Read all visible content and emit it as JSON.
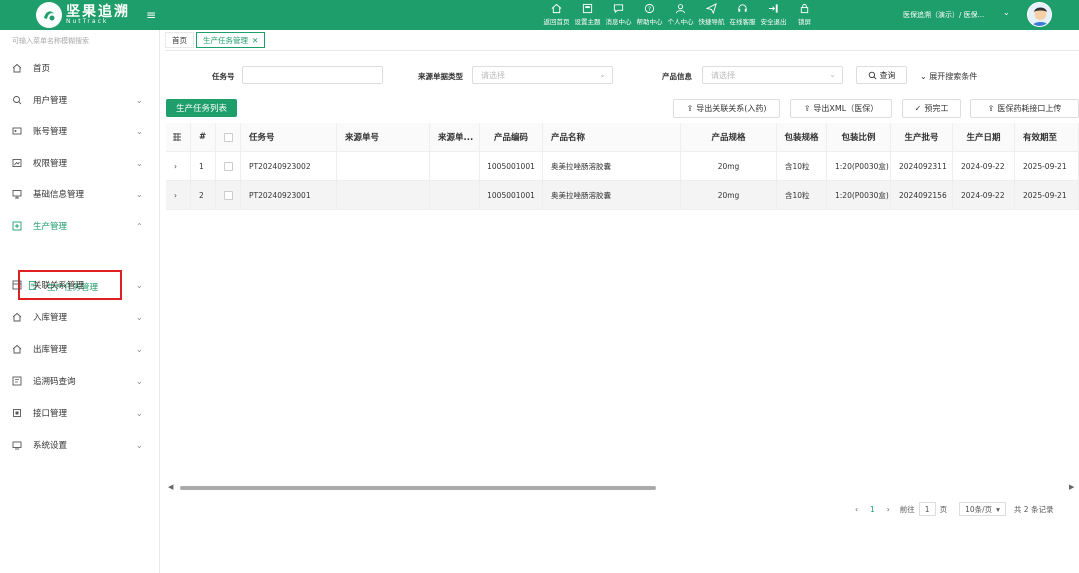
{
  "header": {
    "brand_name": "坚果追溯",
    "brand_sub": "NutTrack",
    "nav": [
      {
        "label": "返回首页",
        "icon": "home-icon"
      },
      {
        "label": "设置主题",
        "icon": "theme-icon"
      },
      {
        "label": "消息中心",
        "icon": "message-icon"
      },
      {
        "label": "帮助中心",
        "icon": "help-icon"
      },
      {
        "label": "个人中心",
        "icon": "user-icon"
      },
      {
        "label": "快捷导航",
        "icon": "send-icon"
      },
      {
        "label": "在线客服",
        "icon": "headset-icon"
      },
      {
        "label": "安全退出",
        "icon": "logout-icon"
      },
      {
        "label": "锁屏",
        "icon": "lock-icon"
      }
    ],
    "user": "医保追溯（演示）/ 医保...",
    "accent": "#1e9e6a"
  },
  "sidebar": {
    "search_placeholder": "可输入菜单名称模糊搜索",
    "items": [
      {
        "label": "首页",
        "icon": "home-icon"
      },
      {
        "label": "用户管理",
        "icon": "user-search-icon"
      },
      {
        "label": "账号管理",
        "icon": "account-icon"
      },
      {
        "label": "权限管理",
        "icon": "permission-icon"
      },
      {
        "label": "基础信息管理",
        "icon": "monitor-icon"
      },
      {
        "label": "生产管理",
        "icon": "production-icon"
      },
      {
        "label": "关联关系管理",
        "icon": "relation-icon"
      },
      {
        "label": "入库管理",
        "icon": "warehouse-in-icon"
      },
      {
        "label": "出库管理",
        "icon": "warehouse-out-icon"
      },
      {
        "label": "追溯码查询",
        "icon": "trace-icon"
      },
      {
        "label": "接口管理",
        "icon": "api-icon"
      },
      {
        "label": "系统设置",
        "icon": "settings-icon"
      }
    ],
    "sub_item": "生产任务管理"
  },
  "tabs": [
    {
      "label": "首页"
    },
    {
      "label": "生产任务管理"
    }
  ],
  "filters": {
    "task_no_label": "任务号",
    "source_type_label": "来源单据类型",
    "source_type_placeholder": "请选择",
    "product_label": "产品信息",
    "product_placeholder": "请选择",
    "query_btn": "查询",
    "expand": "展开搜索条件"
  },
  "toolbar": {
    "list_btn": "生产任务列表",
    "export_rel": "导出关联关系(入药)",
    "export_xml": "导出XML（医保）",
    "pre_complete": "预完工",
    "upload": "医保药耗接口上传"
  },
  "table": {
    "columns": [
      "任务号",
      "来源单号",
      "来源单...",
      "产品编码",
      "产品名称",
      "产品规格",
      "包装规格",
      "包装比例",
      "生产批号",
      "生产日期",
      "有效期至"
    ],
    "rows": [
      {
        "idx": "1",
        "cells": [
          "PT20240923002",
          "",
          "",
          "1005001001",
          "奥美拉唑肠溶胶囊",
          "20mg",
          "含10粒",
          "1:20(P0030盒)",
          "2024092311",
          "2024-09-22",
          "2025-09-21"
        ]
      },
      {
        "idx": "2",
        "cells": [
          "PT20240923001",
          "",
          "",
          "1005001001",
          "奥美拉唑肠溶胶囊",
          "20mg",
          "含10粒",
          "1:20(P0030盒)",
          "2024092156",
          "2024-09-22",
          "2025-09-21"
        ]
      }
    ]
  },
  "pager": {
    "page": "1",
    "goto_label": "前往",
    "goto_value": "1",
    "page_unit": "页",
    "page_size": "10条/页",
    "total": "共 2 条记录"
  }
}
